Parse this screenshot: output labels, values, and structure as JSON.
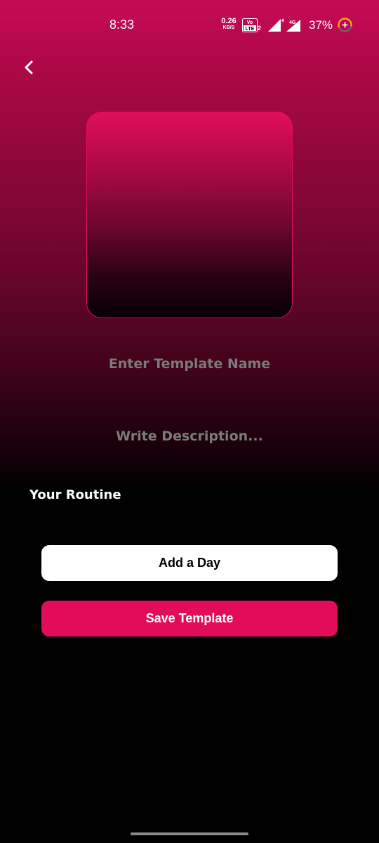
{
  "status_bar": {
    "time": "8:33",
    "net_speed_value": "0.26",
    "net_speed_unit": "KB/S",
    "volte_label_top": "Vo",
    "volte_label_bottom": "LTE",
    "volte_sim": "2",
    "network_type": "4G",
    "battery_percent": "37%",
    "icons": [
      "volte-icon",
      "signal-icon",
      "signal-4g-icon",
      "battery-saver-icon"
    ]
  },
  "header": {
    "back_icon": "chevron-left-icon"
  },
  "form": {
    "name_placeholder": "Enter Template Name",
    "name_value": "",
    "description_placeholder": "Write Description...",
    "description_value": ""
  },
  "routine": {
    "title": "Your Routine"
  },
  "buttons": {
    "add_day": "Add a Day",
    "save_template": "Save Template"
  },
  "colors": {
    "accent": "#e20c5b",
    "background": "#000000",
    "placeholder": "#7b7b7b"
  }
}
